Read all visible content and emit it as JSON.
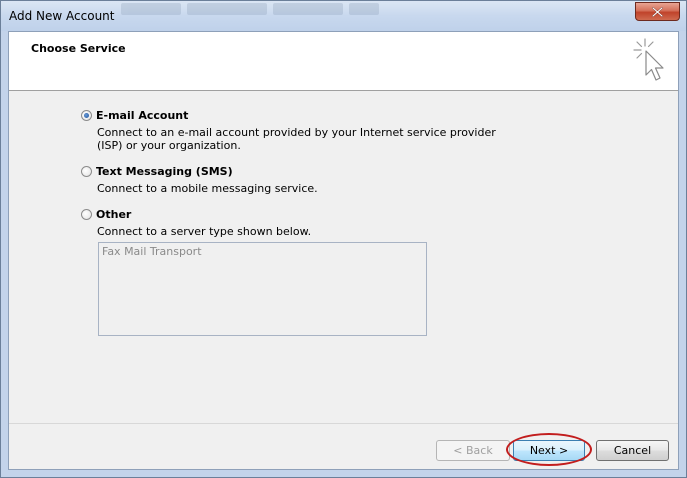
{
  "window": {
    "title": "Add New Account"
  },
  "header": {
    "title": "Choose Service",
    "icon": "cursor-sparkle-icon"
  },
  "options": [
    {
      "label": "E-mail Account",
      "description": "Connect to an e-mail account provided by your Internet service provider (ISP) or your organization.",
      "selected": true
    },
    {
      "label": "Text Messaging (SMS)",
      "description": "Connect to a mobile messaging service.",
      "selected": false
    },
    {
      "label": "Other",
      "description": "Connect to a server type shown below.",
      "selected": false
    }
  ],
  "server_list": {
    "items": [
      "Fax Mail Transport"
    ]
  },
  "buttons": {
    "back": "< Back",
    "next": "Next >",
    "cancel": "Cancel"
  },
  "colors": {
    "highlight": "#c21d1d",
    "title_bar": "#c8d8ee"
  }
}
